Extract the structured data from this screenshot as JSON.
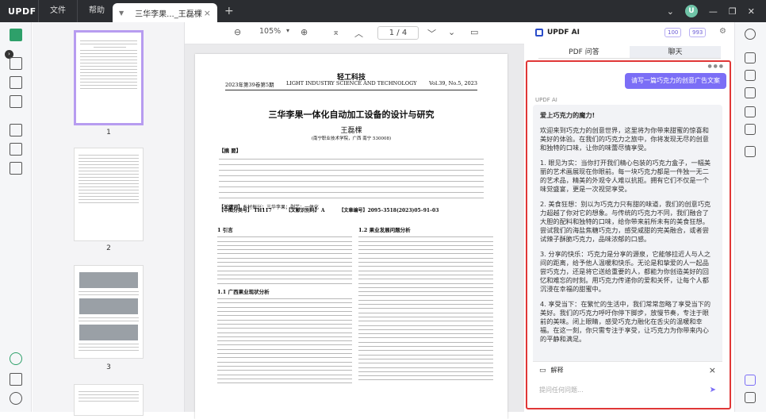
{
  "titlebar": {
    "logo": "UPDF",
    "menu_file": "文件",
    "menu_help": "帮助",
    "tab_title": "三华李果..._王磊棵",
    "tab_close": "×",
    "new_tab": "+",
    "avatar": "U",
    "minimize": "—",
    "restore": "❐",
    "close": "✕"
  },
  "thumbnails": {
    "pages": [
      "1",
      "2",
      "3"
    ]
  },
  "toolbar": {
    "zoom_out": "⊖",
    "zoom": "105%",
    "zoom_dropdown": "▾",
    "zoom_in": "⊕",
    "first_page": "⌅",
    "prev_page": "︿",
    "page_indicator": "1 / 4",
    "next_page": "﹀",
    "last_page": "⌄",
    "comment": "▭"
  },
  "document": {
    "journal": "轻工科技",
    "issue": "2023年第39卷第5期",
    "journal_en": "LIGHT INDUSTRY SCIENCE AND TECHNOLOGY",
    "volume": "Vol.39, No.5, 2023",
    "title": "三华李果一体化自动加工设备的设计与研究",
    "author": "王磊棵",
    "affiliation": "(南宁职业技术学院，广西 南宁 530008)",
    "abstract_label": "【摘 要】",
    "keywords_label": "【关键词】",
    "keywords": "乡村振兴；三华李果；剥芯；一体化",
    "clc_label": "【中图分类号】",
    "clc": "TH117",
    "doc_code_label": "【文献识别码】",
    "doc_code": "A",
    "article_no_label": "【文章编号】",
    "article_no": "2095–3518(2023)05–91–03",
    "section1": "1 引言",
    "section11": "1.1 广西果业现状分析",
    "section12": "1.2 果业发展问题分析"
  },
  "ai": {
    "title": "UPDF AI",
    "credit1": "100",
    "credit2": "993",
    "tab_pdf": "PDF 问答",
    "tab_chat": "聊天",
    "user_message": "请写一篇巧克力的创意广告文案",
    "sender_label": "UPDF AI",
    "answer": {
      "title": "爱上巧克力的魔力!",
      "intro": "欢迎来到巧克力的创意世界，这里将为你带来甜蜜的惊喜和美好的体验。在我们的巧克力之旅中，你将发现无尽的创意和独特的口味，让你的味蕾尽情享受。",
      "p1": "1. 眼见为实：当你打开我们精心包装的巧克力盒子，一幅美丽的艺术画展现在你眼前。每一块巧克力都是一件独一无二的艺术品，精美的外观令人难以抗拒。拥有它们不仅是一个味觉盛宴，更是一次视觉享受。",
      "p2": "2. 美食狂想：别以为巧克力只有甜的味道，我们的创意巧克力超越了你对它的想象。与传统的巧克力不同，我们融合了大胆的配料和独特的口味，给你带来前所未有的美食狂想。尝试我们的海盐焦糖巧克力，感受咸甜的完美融合，或者尝试辣子酥脆巧克力，品味浓郁的口感。",
      "p3": "3. 分享的快乐：巧克力是分享的源泉，它能够拉近人与人之间的距离，给予他人温暖和快乐。无论是和挚爱的人一起品尝巧克力，还是将它送给重要的人，都能为你创造美好的回忆和难忘的时刻。用巧克力传递你的爱和关怀，让每个人都沉浸在幸福的甜蜜中。",
      "p4": "4. 享受当下：在繁忙的生活中，我们常常忽略了享受当下的美好。我们的巧克力呼吁你停下脚步，放慢节奏，专注于眼前的美味。闭上眼睛，感受巧克力融化在舌尖的温暖和幸福。在这一刻，你只需专注于享受，让巧克力为你带来内心的平静和满足。"
    },
    "explain_label": "解释",
    "ask_placeholder": "提问任何问题..."
  }
}
